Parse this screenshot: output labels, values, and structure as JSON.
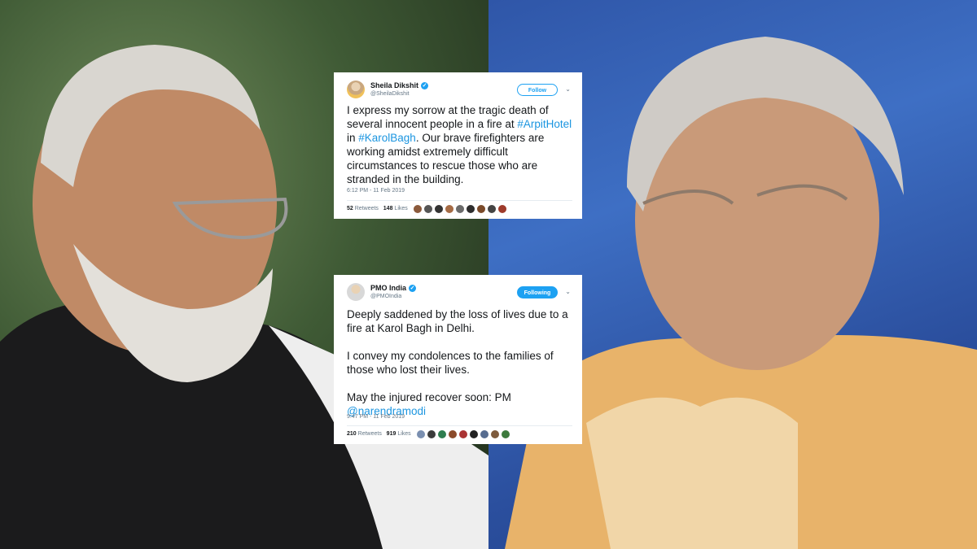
{
  "tweets": [
    {
      "name": "Sheila Dikshit",
      "handle": "@SheilaDikshit",
      "button": "Follow",
      "text_before": "I express my sorrow at the tragic death of several innocent people in a fire at ",
      "hashtag1": "#ArpitHotel",
      "text_mid": " in ",
      "hashtag2": "#KarolBagh",
      "text_after": ". Our brave firefighters are working amidst extremely difficult circumstances to rescue those who are stranded in the building.",
      "timestamp": "6:12 PM - 11 Feb 2019",
      "retweets": "52",
      "retweets_label": "Retweets",
      "likes": "148",
      "likes_label": "Likes"
    },
    {
      "name": "PMO India",
      "handle": "@PMOIndia",
      "button": "Following",
      "para1": "Deeply saddened by the loss of lives due to a fire at Karol Bagh in Delhi.",
      "para2": "I convey my condolences to the families of those who lost their lives.",
      "para3": "May the injured recover soon: PM",
      "mention": "@narendramodi",
      "timestamp": "9:47 PM - 11 Feb 2019",
      "retweets": "210",
      "retweets_label": "Retweets",
      "likes": "919",
      "likes_label": "Likes"
    }
  ],
  "colors": {
    "link": "#1b95e0",
    "verified": "#1da1f2",
    "left_bg": "#3f5a35",
    "right_bg": "#2f56a8"
  },
  "icons": {
    "verified": "verified-badge-icon",
    "menu": "chevron-down-icon"
  }
}
